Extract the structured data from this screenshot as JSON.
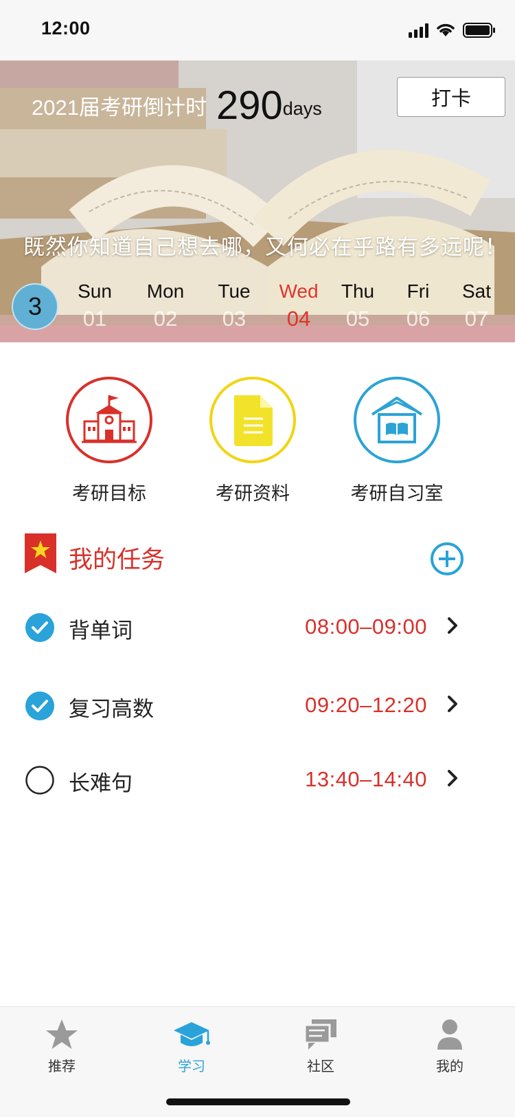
{
  "status_bar": {
    "time": "12:00"
  },
  "banner": {
    "countdown_label": "2021届考研倒计时",
    "countdown_value": "290",
    "countdown_unit": "days",
    "checkin_label": "打卡",
    "motto": "既然你知道自己想去哪，又何必在乎路有多远呢！",
    "week_number": "3",
    "days": [
      {
        "name": "Sun",
        "date": "01"
      },
      {
        "name": "Mon",
        "date": "02"
      },
      {
        "name": "Tue",
        "date": "03"
      },
      {
        "name": "Wed",
        "date": "04"
      },
      {
        "name": "Thu",
        "date": "05"
      },
      {
        "name": "Fri",
        "date": "06"
      },
      {
        "name": "Sat",
        "date": "07"
      }
    ],
    "active_day": "Wed"
  },
  "features": [
    {
      "label": "考研目标",
      "icon": "school-icon",
      "color": "#d9302a"
    },
    {
      "label": "考研资料",
      "icon": "document-icon",
      "color": "#f2d411"
    },
    {
      "label": "考研自习室",
      "icon": "study-room-icon",
      "color": "#2ba3d6"
    }
  ],
  "tasks": {
    "title": "我的任务",
    "items": [
      {
        "name": "背单词",
        "time": "08:00–09:00",
        "done": true
      },
      {
        "name": "复习高数",
        "time": "09:20–12:20",
        "done": true
      },
      {
        "name": "长难句",
        "time": "13:40–14:40",
        "done": false
      }
    ]
  },
  "tab_bar": {
    "items": [
      {
        "label": "推荐",
        "icon": "star-icon"
      },
      {
        "label": "学习",
        "icon": "graduation-cap-icon",
        "active": true
      },
      {
        "label": "社区",
        "icon": "chat-icon"
      },
      {
        "label": "我的",
        "icon": "person-icon"
      }
    ]
  },
  "colors": {
    "accent_red": "#d9302a",
    "accent_blue": "#29a3d9",
    "accent_yellow": "#f2d411"
  }
}
